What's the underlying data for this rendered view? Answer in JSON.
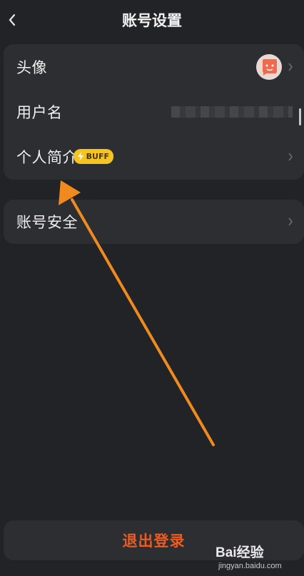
{
  "header": {
    "title": "账号设置",
    "back_icon": "chevron-left-icon"
  },
  "profile_card": {
    "rows": [
      {
        "label": "头像",
        "icon": "avatar-image"
      },
      {
        "label": "用户名"
      },
      {
        "label": "个人简介",
        "badge": "BUFF"
      }
    ]
  },
  "security_card": {
    "label": "账号安全"
  },
  "logout": {
    "label": "退出登录"
  },
  "watermark": {
    "brand": "Bai经验",
    "sub": "jingyan.baidu.com"
  },
  "colors": {
    "background": "#222326",
    "card": "#2d2e31",
    "logout_text": "#f05a1d",
    "badge": "#f6c421",
    "annotation_arrow": "#ef8a1f"
  }
}
